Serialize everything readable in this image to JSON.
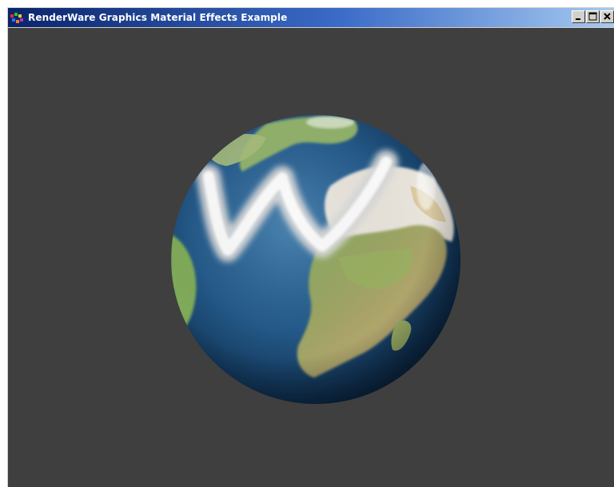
{
  "window": {
    "title": "RenderWare Graphics Material Effects Example",
    "app_icon": "renderware-icon",
    "buttons": {
      "minimize_icon": "minimize-icon",
      "maximize_icon": "maximize-icon",
      "close_icon": "close-icon"
    }
  },
  "viewport": {
    "background_color": "#3f3f3f",
    "scene_object": "earth-globe",
    "overlay_glyph": "W",
    "colors": {
      "ocean": "#2a5f8f",
      "land": "#8aa860",
      "desert": "#c8a878",
      "cloud": "#f2f2f2"
    }
  }
}
